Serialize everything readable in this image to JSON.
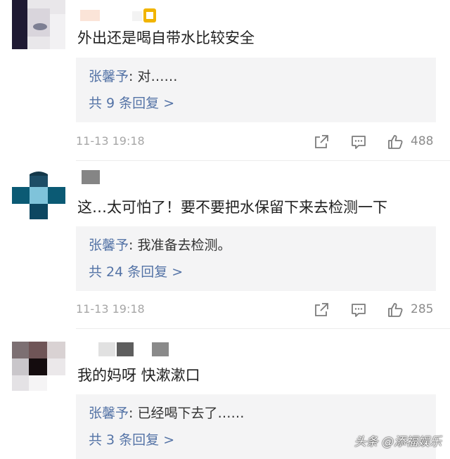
{
  "comments": [
    {
      "content": "外出还是喝自带水比较安全",
      "reply": {
        "author": "张馨予",
        "separator": ": ",
        "text": "对……"
      },
      "more_replies": "共 9 条回复 >",
      "time": "11-13 19:18",
      "likes": "488"
    },
    {
      "content": "这…太可怕了！要不要把水保留下来去检测一下",
      "reply": {
        "author": "张馨予",
        "separator": ": ",
        "text": "我准备去检测。"
      },
      "more_replies": "共 24 条回复 >",
      "time": "11-13 19:18",
      "likes": "285"
    },
    {
      "content": "我的妈呀 快漱漱口",
      "reply": {
        "author": "张馨予",
        "separator": ": ",
        "text": "已经喝下去了……"
      },
      "more_replies": "共 3 条回复 >"
    }
  ],
  "watermark": "头条 @添福娱乐",
  "colors": {
    "link": "#5473a6",
    "reply_bg": "#f4f4f5",
    "meta_text": "#a6a6a6"
  },
  "icons": [
    "share-icon",
    "comment-icon",
    "like-icon"
  ]
}
